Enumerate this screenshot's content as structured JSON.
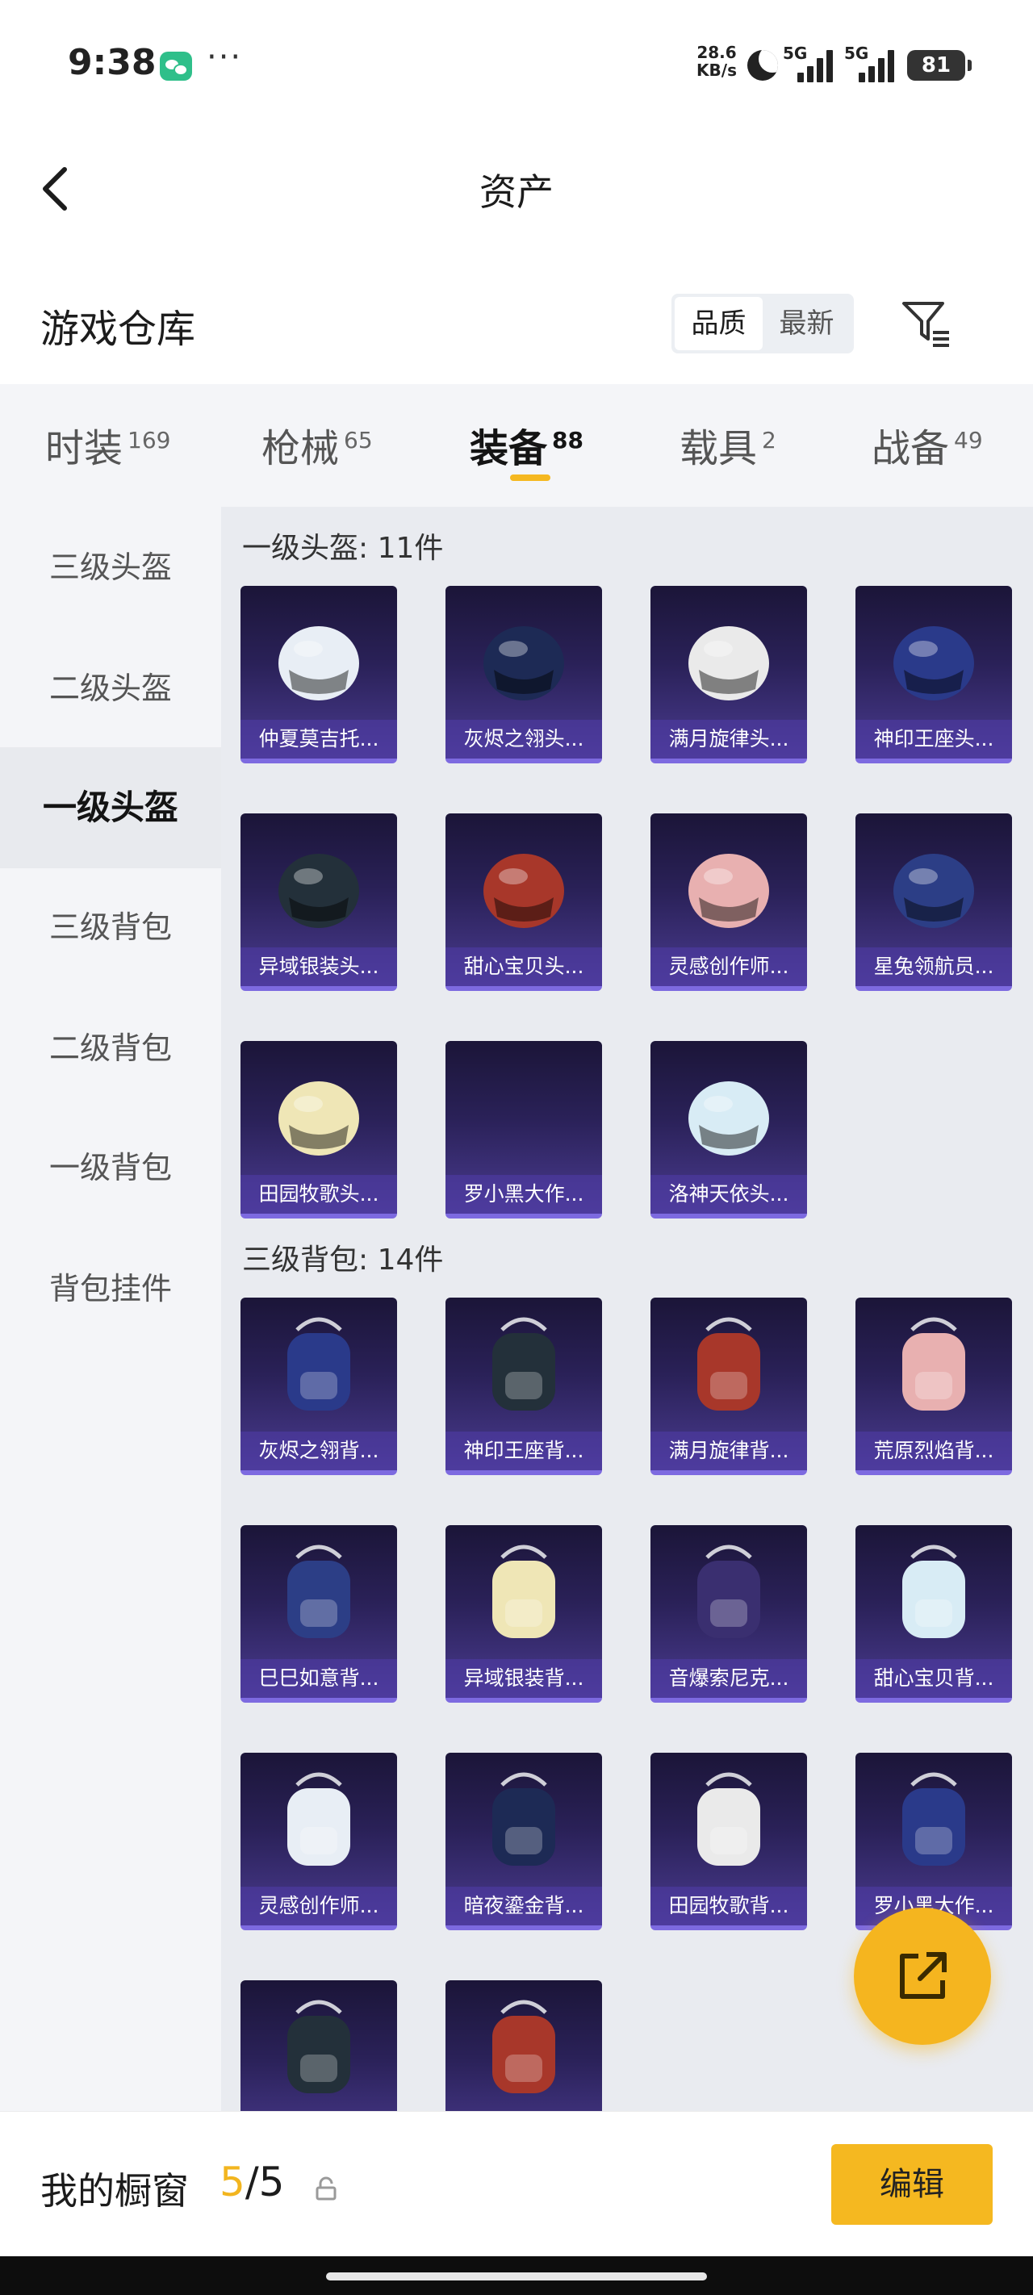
{
  "status_bar": {
    "time": "9:38",
    "dots": "···",
    "net_speed_value": "28.6",
    "net_speed_unit": "KB/s",
    "signal_1": "5G",
    "signal_2": "5G",
    "battery": "81",
    "icons": [
      "wechat-icon",
      "moon-icon",
      "signal-icon",
      "battery-icon"
    ]
  },
  "header": {
    "title": "资产",
    "back_icon": "chevron-left-icon"
  },
  "warehouse": {
    "title": "游戏仓库",
    "sort_options": [
      "品质",
      "最新"
    ],
    "sort_selected": "品质",
    "filter_icon": "filter-icon"
  },
  "tabs": [
    {
      "label": "时装",
      "count": "169"
    },
    {
      "label": "枪械",
      "count": "65"
    },
    {
      "label": "装备",
      "count": "88"
    },
    {
      "label": "载具",
      "count": "2"
    },
    {
      "label": "战备",
      "count": "49"
    }
  ],
  "active_tab": "装备",
  "sidebar": {
    "items": [
      "三级头盔",
      "二级头盔",
      "一级头盔",
      "三级背包",
      "二级背包",
      "一级背包",
      "背包挂件"
    ],
    "active": "一级头盔"
  },
  "sections": [
    {
      "title": "一级头盔: 11件",
      "items": [
        "仲夏莫吉托...",
        "灰烬之翎头...",
        "满月旋律头...",
        "神印王座头...",
        "异域银装头...",
        "甜心宝贝头...",
        "灵感创作师...",
        "星兔领航员...",
        "田园牧歌头...",
        "罗小黑大作...",
        "洛神天依头..."
      ]
    },
    {
      "title": "三级背包: 14件",
      "items": [
        "灰烬之翎背...",
        "神印王座背...",
        "满月旋律背...",
        "荒原烈焰背...",
        "巳巳如意背...",
        "异域银装背...",
        "音爆索尼克...",
        "甜心宝贝背...",
        "灵感创作师...",
        "暗夜鎏金背...",
        "田园牧歌背...",
        "罗小黑大作...",
        "",
        ""
      ]
    }
  ],
  "fab": {
    "icon": "share-external-icon"
  },
  "footer": {
    "label": "我的橱窗",
    "count_current": "5",
    "count_sep": "/",
    "count_total": "5",
    "lock_icon": "lock-icon",
    "edit_label": "编辑"
  },
  "colors": {
    "accent": "#f5b820",
    "card_bg": "#2a2158",
    "card_border": "#7d6ae0",
    "panel_bg": "#f4f5f8"
  }
}
